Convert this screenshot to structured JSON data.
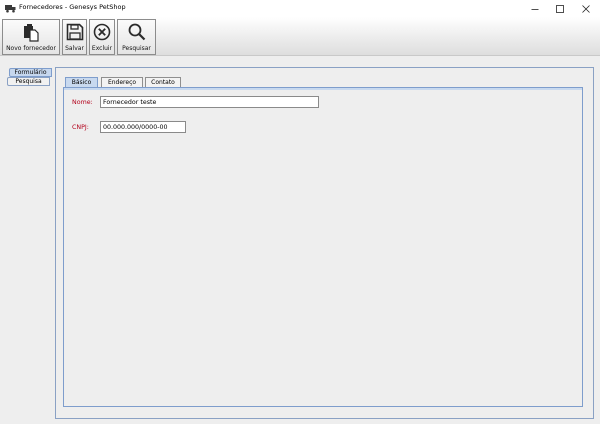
{
  "window": {
    "title": "Fornecedores - Genesys PetShop",
    "icon": "truck-icon",
    "controls": [
      "minimize-icon",
      "maximize-icon",
      "close-icon"
    ]
  },
  "toolbar": {
    "novo_label": "Novo fornecedor",
    "salvar_label": "Salvar",
    "excluir_label": "Excluir",
    "pesquisar_label": "Pesquisar"
  },
  "side_tabs": {
    "formulario": "Formulário",
    "pesquisa": "Pesquisa",
    "active": "Formulário"
  },
  "inner_tabs": {
    "basico": "Básico",
    "endereco": "Endereço",
    "contato": "Contato",
    "active": "Básico"
  },
  "form": {
    "nome_label": "Nome:",
    "nome_value": "Fornecedor teste",
    "cnpj_label": "CNPJ:",
    "cnpj_value": "00.000.000/0000-00"
  },
  "colors": {
    "label_red": "#b3001b",
    "active_tab": "#c8d9ef",
    "panel_border": "#7e9dcc"
  }
}
